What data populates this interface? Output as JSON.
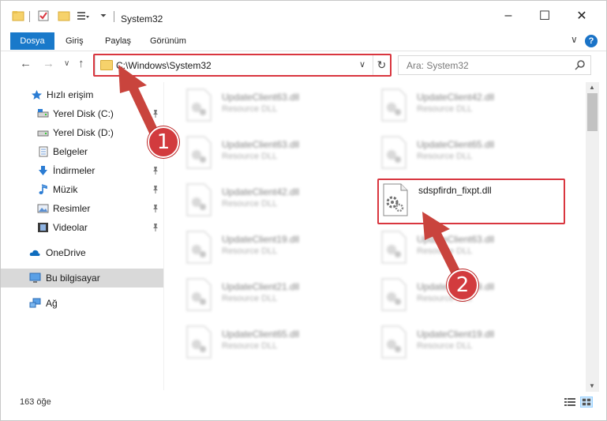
{
  "window": {
    "title": "System32",
    "controls": {
      "minimize": "–",
      "maximize": "☐",
      "close": "✕"
    }
  },
  "ribbon": {
    "tabs": [
      "Dosya",
      "Giriş",
      "Paylaş",
      "Görünüm"
    ],
    "help": "?",
    "expand": "∨"
  },
  "navigation": {
    "back": "←",
    "forward": "→",
    "recent": "∨",
    "up": "↑",
    "address": "C:\\Windows\\System32",
    "address_dropdown": "∨",
    "refresh": "↻",
    "search_placeholder": "Ara: System32"
  },
  "sidebar": {
    "items": [
      {
        "label": "Hızlı erişim",
        "icon": "star-icon"
      },
      {
        "label": "Yerel Disk (C:)",
        "icon": "drive-icon",
        "pinned": true
      },
      {
        "label": "Yerel Disk (D:)",
        "icon": "drive-icon"
      },
      {
        "label": "Belgeler",
        "icon": "documents-icon",
        "pinned": true
      },
      {
        "label": "İndirmeler",
        "icon": "download-icon",
        "pinned": true
      },
      {
        "label": "Müzik",
        "icon": "music-icon",
        "pinned": true
      },
      {
        "label": "Resimler",
        "icon": "pictures-icon",
        "pinned": true
      },
      {
        "label": "Videolar",
        "icon": "videos-icon",
        "pinned": true
      },
      {
        "label": "OneDrive",
        "icon": "cloud-icon"
      },
      {
        "label": "Bu bilgisayar",
        "icon": "computer-icon",
        "selected": true
      },
      {
        "label": "Ağ",
        "icon": "network-icon"
      }
    ]
  },
  "files": {
    "left": [
      {
        "name": "UpdateClient63.dll",
        "type": "Resource DLL"
      },
      {
        "name": "UpdateClient63.dll",
        "type": "Resource DLL"
      },
      {
        "name": "UpdateClient42.dll",
        "type": "Resource DLL"
      },
      {
        "name": "UpdateClient19.dll",
        "type": "Resource DLL"
      },
      {
        "name": "UpdateClient21.dll",
        "type": "Resource DLL"
      },
      {
        "name": "UpdateClient65.dll",
        "type": "Resource DLL"
      }
    ],
    "right": [
      {
        "name": "UpdateClient42.dll",
        "type": "Resource DLL"
      },
      {
        "name": "UpdateClient65.dll",
        "type": "Resource DLL"
      },
      {
        "name": "sdspfirdn_fixpt.dll",
        "type": "",
        "highlighted": true
      },
      {
        "name": "UpdateClient63.dll",
        "type": "Resource DLL"
      },
      {
        "name": "UpdateClient19.dll",
        "type": "Resource DLL"
      },
      {
        "name": "UpdateClient19.dll",
        "type": "Resource DLL"
      }
    ]
  },
  "status": {
    "count": "163 öğe"
  },
  "annotations": {
    "step1": "1",
    "step2": "2",
    "color": "#d23b3e"
  }
}
